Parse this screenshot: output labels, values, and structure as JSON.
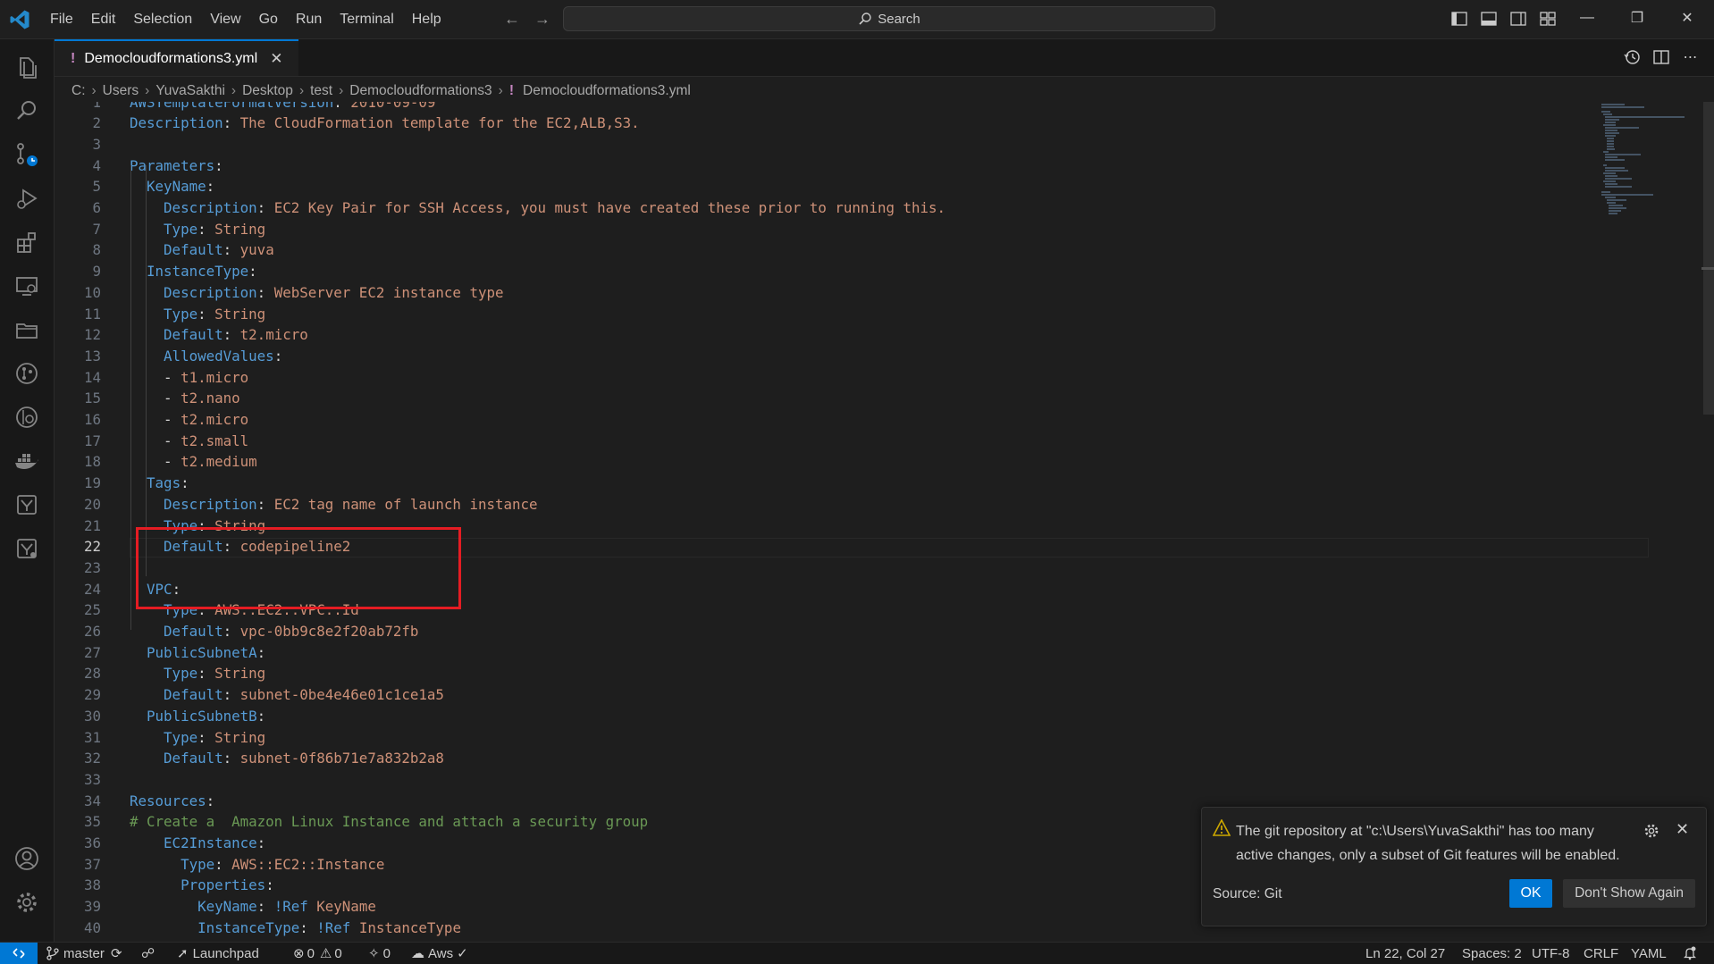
{
  "window": {
    "menu": [
      "File",
      "Edit",
      "Selection",
      "View",
      "Go",
      "Run",
      "Terminal",
      "Help"
    ],
    "search_placeholder": "Search"
  },
  "tab": {
    "filename": "Democloudformations3.yml",
    "modified_marker": "!"
  },
  "breadcrumb": [
    "C:",
    "Users",
    "YuvaSakthi",
    "Desktop",
    "test",
    "Democloudformations3",
    "Democloudformations3.yml"
  ],
  "editor": {
    "current_line": 22,
    "lines": [
      {
        "n": "1",
        "t": [
          {
            "c": "k",
            "s": "AWSTemplateFormatVersion"
          },
          {
            "c": "p",
            "s": ": "
          },
          {
            "c": "v",
            "s": "2010-09-09"
          }
        ]
      },
      {
        "n": "2",
        "t": [
          {
            "c": "k",
            "s": "Description"
          },
          {
            "c": "p",
            "s": ": "
          },
          {
            "c": "v",
            "s": "The CloudFormation template for the EC2,ALB,S3."
          }
        ]
      },
      {
        "n": "3",
        "t": []
      },
      {
        "n": "4",
        "t": [
          {
            "c": "k",
            "s": "Parameters"
          },
          {
            "c": "p",
            "s": ":"
          }
        ]
      },
      {
        "n": "5",
        "t": [
          {
            "c": "p",
            "s": "  "
          },
          {
            "c": "k",
            "s": "KeyName"
          },
          {
            "c": "p",
            "s": ":"
          }
        ]
      },
      {
        "n": "6",
        "t": [
          {
            "c": "p",
            "s": "    "
          },
          {
            "c": "k",
            "s": "Description"
          },
          {
            "c": "p",
            "s": ": "
          },
          {
            "c": "v",
            "s": "EC2 Key Pair for SSH Access, you must have created these prior to running this."
          }
        ]
      },
      {
        "n": "7",
        "t": [
          {
            "c": "p",
            "s": "    "
          },
          {
            "c": "k",
            "s": "Type"
          },
          {
            "c": "p",
            "s": ": "
          },
          {
            "c": "v",
            "s": "String"
          }
        ]
      },
      {
        "n": "8",
        "t": [
          {
            "c": "p",
            "s": "    "
          },
          {
            "c": "k",
            "s": "Default"
          },
          {
            "c": "p",
            "s": ": "
          },
          {
            "c": "v",
            "s": "yuva"
          }
        ]
      },
      {
        "n": "9",
        "t": [
          {
            "c": "p",
            "s": "  "
          },
          {
            "c": "k",
            "s": "InstanceType"
          },
          {
            "c": "p",
            "s": ":"
          }
        ]
      },
      {
        "n": "10",
        "t": [
          {
            "c": "p",
            "s": "    "
          },
          {
            "c": "k",
            "s": "Description"
          },
          {
            "c": "p",
            "s": ": "
          },
          {
            "c": "v",
            "s": "WebServer EC2 instance type"
          }
        ]
      },
      {
        "n": "11",
        "t": [
          {
            "c": "p",
            "s": "    "
          },
          {
            "c": "k",
            "s": "Type"
          },
          {
            "c": "p",
            "s": ": "
          },
          {
            "c": "v",
            "s": "String"
          }
        ]
      },
      {
        "n": "12",
        "t": [
          {
            "c": "p",
            "s": "    "
          },
          {
            "c": "k",
            "s": "Default"
          },
          {
            "c": "p",
            "s": ": "
          },
          {
            "c": "v",
            "s": "t2.micro"
          }
        ]
      },
      {
        "n": "13",
        "t": [
          {
            "c": "p",
            "s": "    "
          },
          {
            "c": "k",
            "s": "AllowedValues"
          },
          {
            "c": "p",
            "s": ":"
          }
        ]
      },
      {
        "n": "14",
        "t": [
          {
            "c": "p",
            "s": "    - "
          },
          {
            "c": "v",
            "s": "t1.micro"
          }
        ]
      },
      {
        "n": "15",
        "t": [
          {
            "c": "p",
            "s": "    - "
          },
          {
            "c": "v",
            "s": "t2.nano"
          }
        ]
      },
      {
        "n": "16",
        "t": [
          {
            "c": "p",
            "s": "    - "
          },
          {
            "c": "v",
            "s": "t2.micro"
          }
        ]
      },
      {
        "n": "17",
        "t": [
          {
            "c": "p",
            "s": "    - "
          },
          {
            "c": "v",
            "s": "t2.small"
          }
        ]
      },
      {
        "n": "18",
        "t": [
          {
            "c": "p",
            "s": "    - "
          },
          {
            "c": "v",
            "s": "t2.medium"
          }
        ]
      },
      {
        "n": "19",
        "t": [
          {
            "c": "p",
            "s": "  "
          },
          {
            "c": "k",
            "s": "Tags"
          },
          {
            "c": "p",
            "s": ":"
          }
        ]
      },
      {
        "n": "20",
        "t": [
          {
            "c": "p",
            "s": "    "
          },
          {
            "c": "k",
            "s": "Description"
          },
          {
            "c": "p",
            "s": ": "
          },
          {
            "c": "v",
            "s": "EC2 tag name of launch instance"
          }
        ]
      },
      {
        "n": "21",
        "t": [
          {
            "c": "p",
            "s": "    "
          },
          {
            "c": "k",
            "s": "Type"
          },
          {
            "c": "p",
            "s": ": "
          },
          {
            "c": "v",
            "s": "String"
          }
        ]
      },
      {
        "n": "22",
        "t": [
          {
            "c": "p",
            "s": "    "
          },
          {
            "c": "k",
            "s": "Default"
          },
          {
            "c": "p",
            "s": ": "
          },
          {
            "c": "v",
            "s": "codepipeline2"
          }
        ]
      },
      {
        "n": "23",
        "t": []
      },
      {
        "n": "24",
        "t": [
          {
            "c": "p",
            "s": "  "
          },
          {
            "c": "k",
            "s": "VPC"
          },
          {
            "c": "p",
            "s": ":"
          }
        ]
      },
      {
        "n": "25",
        "t": [
          {
            "c": "p",
            "s": "    "
          },
          {
            "c": "k",
            "s": "Type"
          },
          {
            "c": "p",
            "s": ": "
          },
          {
            "c": "v",
            "s": "AWS::EC2::VPC::Id"
          }
        ]
      },
      {
        "n": "26",
        "t": [
          {
            "c": "p",
            "s": "    "
          },
          {
            "c": "k",
            "s": "Default"
          },
          {
            "c": "p",
            "s": ": "
          },
          {
            "c": "v",
            "s": "vpc-0bb9c8e2f20ab72fb"
          }
        ]
      },
      {
        "n": "27",
        "t": [
          {
            "c": "p",
            "s": "  "
          },
          {
            "c": "k",
            "s": "PublicSubnetA"
          },
          {
            "c": "p",
            "s": ":"
          }
        ]
      },
      {
        "n": "28",
        "t": [
          {
            "c": "p",
            "s": "    "
          },
          {
            "c": "k",
            "s": "Type"
          },
          {
            "c": "p",
            "s": ": "
          },
          {
            "c": "v",
            "s": "String"
          }
        ]
      },
      {
        "n": "29",
        "t": [
          {
            "c": "p",
            "s": "    "
          },
          {
            "c": "k",
            "s": "Default"
          },
          {
            "c": "p",
            "s": ": "
          },
          {
            "c": "v",
            "s": "subnet-0be4e46e01c1ce1a5"
          }
        ]
      },
      {
        "n": "30",
        "t": [
          {
            "c": "p",
            "s": "  "
          },
          {
            "c": "k",
            "s": "PublicSubnetB"
          },
          {
            "c": "p",
            "s": ":"
          }
        ]
      },
      {
        "n": "31",
        "t": [
          {
            "c": "p",
            "s": "    "
          },
          {
            "c": "k",
            "s": "Type"
          },
          {
            "c": "p",
            "s": ": "
          },
          {
            "c": "v",
            "s": "String"
          }
        ]
      },
      {
        "n": "32",
        "t": [
          {
            "c": "p",
            "s": "    "
          },
          {
            "c": "k",
            "s": "Default"
          },
          {
            "c": "p",
            "s": ": "
          },
          {
            "c": "v",
            "s": "subnet-0f86b71e7a832b2a8"
          }
        ]
      },
      {
        "n": "33",
        "t": []
      },
      {
        "n": "34",
        "t": [
          {
            "c": "k",
            "s": "Resources"
          },
          {
            "c": "p",
            "s": ":"
          }
        ]
      },
      {
        "n": "35",
        "t": [
          {
            "c": "c",
            "s": "# Create a  Amazon Linux Instance and attach a security group"
          }
        ]
      },
      {
        "n": "36",
        "t": [
          {
            "c": "p",
            "s": "    "
          },
          {
            "c": "k",
            "s": "EC2Instance"
          },
          {
            "c": "p",
            "s": ":"
          }
        ]
      },
      {
        "n": "37",
        "t": [
          {
            "c": "p",
            "s": "      "
          },
          {
            "c": "k",
            "s": "Type"
          },
          {
            "c": "p",
            "s": ": "
          },
          {
            "c": "v",
            "s": "AWS::EC2::Instance"
          }
        ]
      },
      {
        "n": "38",
        "t": [
          {
            "c": "p",
            "s": "      "
          },
          {
            "c": "k",
            "s": "Properties"
          },
          {
            "c": "p",
            "s": ":"
          }
        ]
      },
      {
        "n": "39",
        "t": [
          {
            "c": "p",
            "s": "        "
          },
          {
            "c": "k",
            "s": "KeyName"
          },
          {
            "c": "p",
            "s": ": "
          },
          {
            "c": "k",
            "s": "!Ref"
          },
          {
            "c": "p",
            "s": " "
          },
          {
            "c": "v",
            "s": "KeyName"
          }
        ]
      },
      {
        "n": "40",
        "t": [
          {
            "c": "p",
            "s": "        "
          },
          {
            "c": "k",
            "s": "InstanceType"
          },
          {
            "c": "p",
            "s": ": "
          },
          {
            "c": "k",
            "s": "!Ref"
          },
          {
            "c": "p",
            "s": " "
          },
          {
            "c": "v",
            "s": "InstanceType"
          }
        ]
      }
    ]
  },
  "notification": {
    "message": "The git repository at \"c:\\Users\\YuvaSakthi\" has too many active changes, only a subset of Git features will be enabled.",
    "source": "Source: Git",
    "ok_label": "OK",
    "dont_show_label": "Don't Show Again"
  },
  "statusbar": {
    "branch": "master",
    "launchpad": "Launchpad",
    "errors": "0",
    "warnings": "0",
    "ports": "0",
    "aws": "Aws",
    "position": "Ln 22, Col 27",
    "spaces": "Spaces: 2",
    "encoding": "UTF-8",
    "eol": "CRLF",
    "language": "YAML"
  },
  "colors": {
    "accent": "#0078d4",
    "highlight_box": "#e51c23"
  }
}
